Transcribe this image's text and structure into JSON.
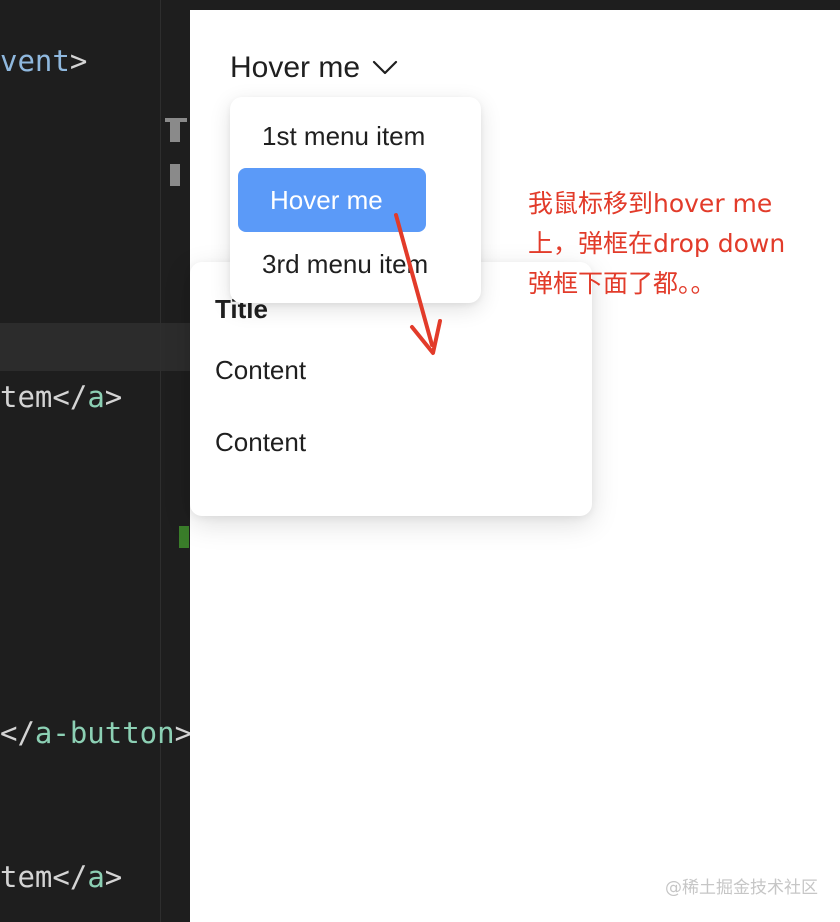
{
  "editor": {
    "lines": [
      {
        "part1": "vent",
        "part2": ">"
      },
      {
        "part1": "tem",
        "part2": "</",
        "part3": "a",
        "part4": ">"
      },
      {
        "part1": "</",
        "part2": "a-button",
        "part3": ">"
      },
      {
        "part1": "tem",
        "part2": "</",
        "part3": "a",
        "part4": ">"
      }
    ]
  },
  "dropdown": {
    "trigger_label": "Hover me",
    "items": [
      {
        "label": "1st menu item"
      },
      {
        "label": "Hover me"
      },
      {
        "label": "3rd menu item"
      }
    ]
  },
  "popover": {
    "title": "Title",
    "contents": [
      "Content",
      "Content"
    ]
  },
  "annotation": {
    "lines": [
      "我鼠标移到hover me",
      "上，弹框在drop down",
      "弹框下面了都。。"
    ]
  },
  "watermark": "@稀土掘金技术社区",
  "colors": {
    "editor_bg": "#1e1e1e",
    "active_item_bg": "#5b9af8",
    "annotation": "#e23b2a"
  }
}
